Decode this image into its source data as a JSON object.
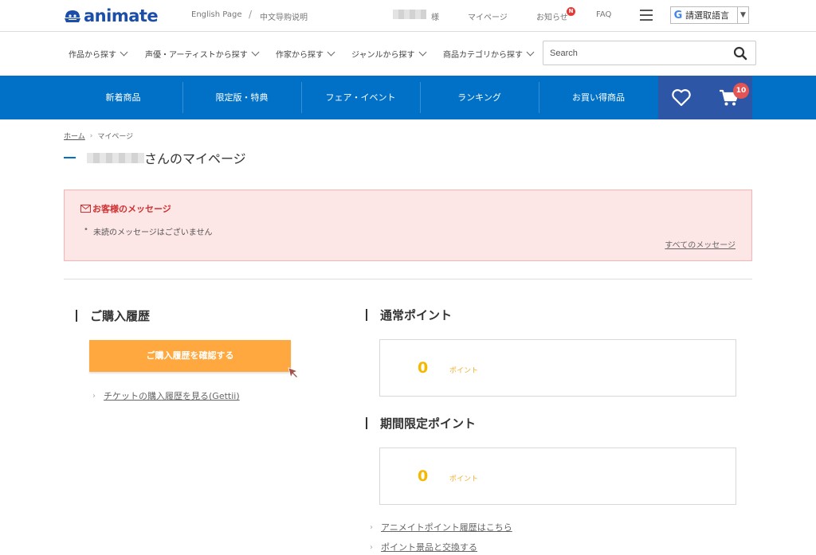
{
  "header": {
    "logo_text": "animate",
    "english_link": "English Page",
    "divider": "/",
    "chinese_link": "中文导购说明",
    "user_suffix": "様",
    "mypage_link": "マイページ",
    "notice_link": "お知らせ",
    "notice_badge": "N",
    "faq_link": "FAQ",
    "translate_label": "請選取語言",
    "translate_arrow": "▼"
  },
  "category_nav": {
    "items": [
      {
        "label": "作品から探す"
      },
      {
        "label": "声優・アーティストから探す"
      },
      {
        "label": "作家から探す"
      },
      {
        "label": "ジャンルから探す"
      },
      {
        "label": "商品カテゴリから探す"
      }
    ],
    "search_placeholder": "Search"
  },
  "main_nav": {
    "items": [
      {
        "label": "新着商品"
      },
      {
        "label": "限定版・特典"
      },
      {
        "label": "フェア・イベント"
      },
      {
        "label": "ランキング"
      },
      {
        "label": "お買い得商品"
      }
    ],
    "cart_count": "10"
  },
  "breadcrumb": {
    "home": "ホーム",
    "separator": "›",
    "current": "マイページ"
  },
  "page": {
    "title_suffix": "さんのマイページ"
  },
  "messages": {
    "title": "お客様のメッセージ",
    "items": [
      "未読のメッセージはございません"
    ],
    "all_link": "すべてのメッセージ"
  },
  "purchase_history": {
    "title": "ご購入履歴",
    "button_label": "ご購入履歴を確認する",
    "ticket_link": "チケットの購入履歴を見る(Gettii)"
  },
  "points": {
    "normal_title": "通常ポイント",
    "normal_value": "0",
    "unit": "ポイント",
    "limited_title": "期間限定ポイント",
    "limited_value": "0",
    "history_link": "アニメイトポイント履歴はこちら",
    "exchange_link": "ポイント景品と交換する"
  },
  "colors": {
    "brand_blue": "#0071c7",
    "nav_dark_blue": "#2d56a6",
    "orange_button": "#ffa83f",
    "point_yellow": "#f5b800",
    "message_bg": "#fde6e6",
    "message_red": "#d03030"
  }
}
